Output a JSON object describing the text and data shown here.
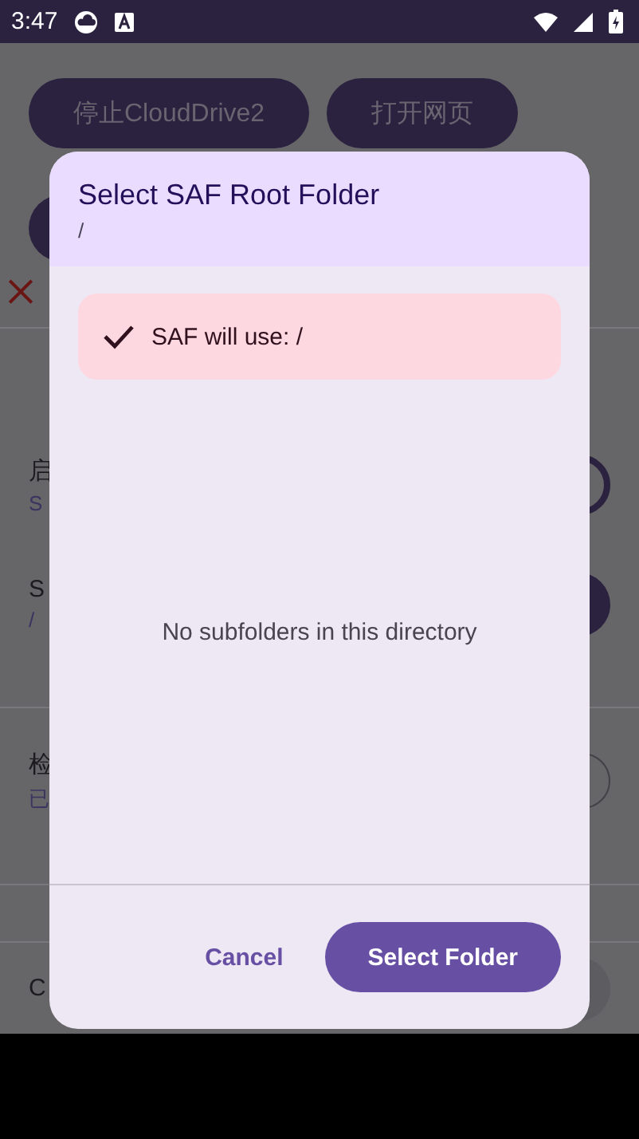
{
  "status_bar": {
    "time": "3:47"
  },
  "background": {
    "buttons": [
      "停止CloudDrive2",
      "打开网页"
    ],
    "sections": [
      [
        {
          "title": "启",
          "subtitle": "S",
          "kind": "ring"
        },
        {
          "title": "S",
          "subtitle": "/",
          "kind": "filled"
        }
      ],
      [
        {
          "title": "检",
          "subtitle": "已",
          "kind": "ring_thin"
        }
      ]
    ],
    "footer_row": {
      "title": "C",
      "kind": "pill"
    }
  },
  "dialog": {
    "title": "Select SAF Root Folder",
    "path": "/",
    "banner": {
      "text": "SAF will use: /"
    },
    "empty_message": "No subfolders in this directory",
    "buttons": [
      {
        "label": "Cancel",
        "kind": "text"
      },
      {
        "label": "Select Folder",
        "kind": "filled"
      }
    ]
  }
}
